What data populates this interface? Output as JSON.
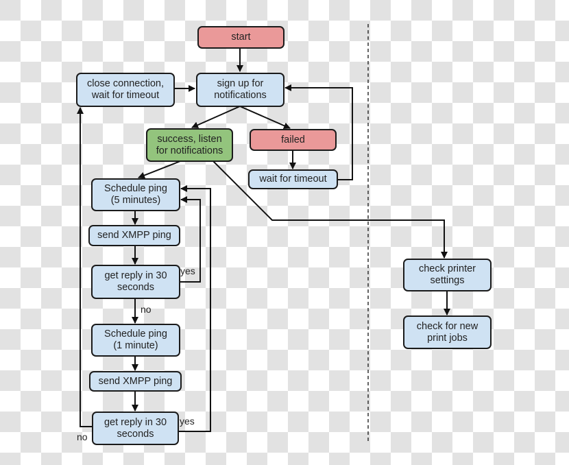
{
  "colors": {
    "blue": "#cfe2f3",
    "red": "#ea9999",
    "green": "#93c47d",
    "stroke": "#111111"
  },
  "nodes": {
    "start": {
      "label": "start",
      "color": "red"
    },
    "close_connection": {
      "label": "close connection,\nwait for timeout",
      "color": "blue"
    },
    "sign_up": {
      "label": "sign up for\nnotifications",
      "color": "blue"
    },
    "success": {
      "label": "success, listen\nfor notifications",
      "color": "green"
    },
    "failed": {
      "label": "failed",
      "color": "red"
    },
    "wait_timeout": {
      "label": "wait for timeout",
      "color": "blue"
    },
    "schedule_5": {
      "label": "Schedule ping\n(5 minutes)",
      "color": "blue"
    },
    "send_ping_1": {
      "label": "send XMPP ping",
      "color": "blue"
    },
    "get_reply_1": {
      "label": "get reply in 30\nseconds",
      "color": "blue"
    },
    "schedule_1": {
      "label": "Schedule ping\n(1 minute)",
      "color": "blue"
    },
    "send_ping_2": {
      "label": "send XMPP ping",
      "color": "blue"
    },
    "get_reply_2": {
      "label": "get reply in 30\nseconds",
      "color": "blue"
    },
    "check_printer": {
      "label": "check printer\nsettings",
      "color": "blue"
    },
    "check_jobs": {
      "label": "check for new\nprint jobs",
      "color": "blue"
    }
  },
  "edge_labels": {
    "yes_1": "yes",
    "no_1": "no",
    "yes_2": "yes",
    "no_2": "no"
  }
}
